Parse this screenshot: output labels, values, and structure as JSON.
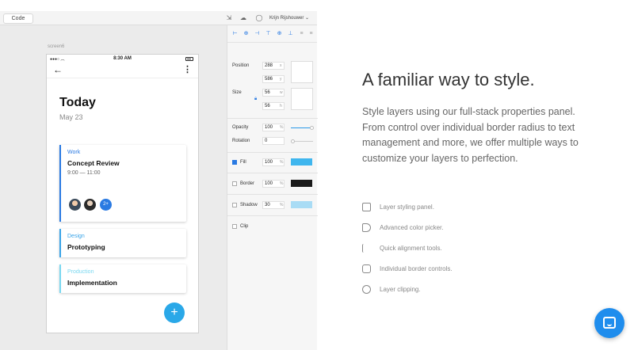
{
  "toolbar": {
    "code_label": "Code",
    "user_name": "Krijn Rijshouwer ⌄"
  },
  "canvas": {
    "screen_label": "screen6"
  },
  "phone": {
    "time": "8:30 AM",
    "title": "Today",
    "date": "May 23",
    "cards": [
      {
        "tag": "Work",
        "name": "Concept Review",
        "time": "9:00 — 11:00",
        "color": "#2a7ae2",
        "avatars_more": "2+"
      },
      {
        "tag": "Design",
        "name": "Prototyping",
        "color": "#3aa4e8"
      },
      {
        "tag": "Production",
        "name": "Implementation",
        "color": "#7ad8f0"
      }
    ],
    "fab_label": "+"
  },
  "panel": {
    "position_label": "Position",
    "pos_x": "288",
    "pos_y": "586",
    "size_label": "Size",
    "width": "56",
    "height": "56",
    "opacity_label": "Opacity",
    "opacity": "100",
    "rotation_label": "Rotation",
    "rotation": "0",
    "fill_label": "Fill",
    "fill_value": "100",
    "fill_color": "#3fb6ee",
    "border_label": "Border",
    "border_value": "100",
    "border_color": "#1a1a1a",
    "shadow_label": "Shadow",
    "shadow_value": "30",
    "shadow_color": "#a9dcf5",
    "clip_label": "Clip",
    "unit_x": "x",
    "unit_y": "y",
    "unit_w": "w",
    "unit_h": "h",
    "unit_pct": "%"
  },
  "copy": {
    "headline": "A familiar way to style.",
    "description": "Style layers using our full-stack properties panel. From control over individual border radius to text management and more, we offer multiple ways to customize your layers to perfection."
  },
  "features": [
    {
      "label": "Layer styling panel."
    },
    {
      "label": "Advanced color picker."
    },
    {
      "label": "Quick alignment tools."
    },
    {
      "label": "Individual border controls."
    },
    {
      "label": "Layer clipping."
    }
  ],
  "colors": {
    "accent": "#2a7ae2",
    "chat": "#1f8ded"
  }
}
